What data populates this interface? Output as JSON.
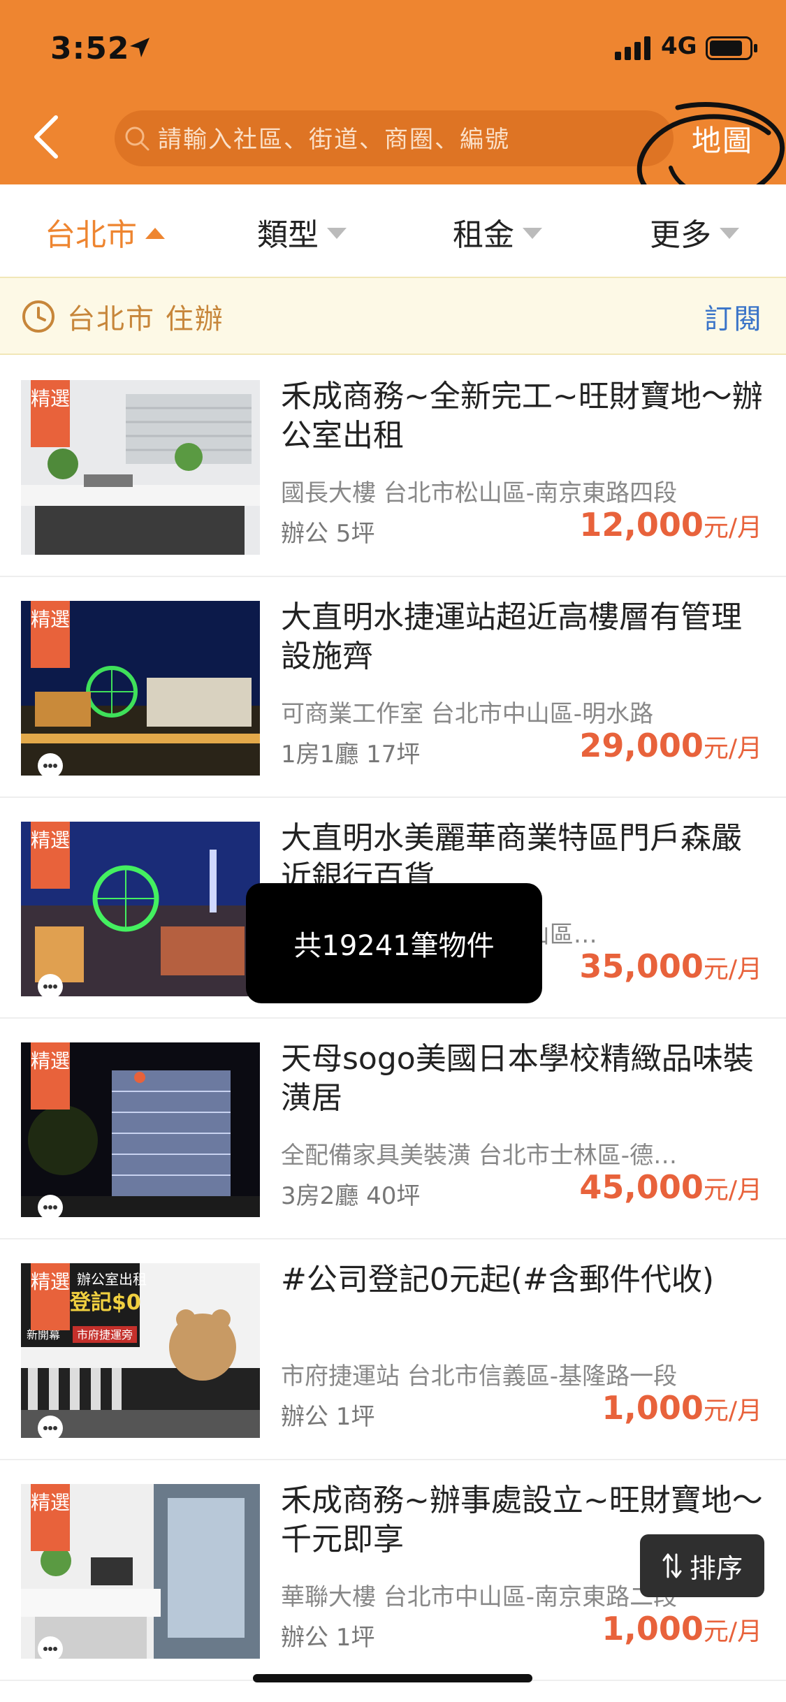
{
  "status_bar": {
    "time": "3:52",
    "network": "4G"
  },
  "header": {
    "search_placeholder": "請輸入社區、街道、商圈、編號",
    "map_label": "地圖"
  },
  "filters": [
    {
      "label": "台北市"
    },
    {
      "label": "類型"
    },
    {
      "label": "租金"
    },
    {
      "label": "更多"
    }
  ],
  "subscription": {
    "text": "台北市 住辦",
    "action": "訂閱"
  },
  "listings": [
    {
      "badge": "精選",
      "title": "禾成商務~全新完工~旺財寶地～辦公室出租",
      "location": "國長大樓 台北市松山區-南京東路四段",
      "spec": "辦公  5坪",
      "price": "12,000",
      "unit": "元/月"
    },
    {
      "badge": "精選",
      "title": "大直明水捷運站超近高樓層有管理設施齊",
      "location": "可商業工作室 台北市中山區-明水路",
      "spec": "1房1廳  17坪",
      "price": "29,000",
      "unit": "元/月"
    },
    {
      "badge": "精選",
      "title": "大直明水美麗華商業特區門戶森嚴近銀行百貨",
      "location": "可商業工作室 台北市中山區…",
      "spec": "",
      "price": "35,000",
      "unit": "元/月"
    },
    {
      "badge": "精選",
      "title": "天母sogo美國日本學校精緻品味裝潢居",
      "location": "全配備家具美裝潢 台北市士林區-德…",
      "spec": "3房2廳  40坪",
      "price": "45,000",
      "unit": "元/月"
    },
    {
      "badge": "精選",
      "title": "#公司登記0元起(#含郵件代收)",
      "location": "市府捷運站 台北市信義區-基隆路一段",
      "spec": "辦公  1坪",
      "price": "1,000",
      "unit": "元/月"
    },
    {
      "badge": "精選",
      "title": "禾成商務~辦事處設立~旺財寶地～千元即享",
      "location": "華聯大樓 台北市中山區-南京東路二段",
      "spec": "辦公  1坪",
      "price": "1,000",
      "unit": "元/月"
    }
  ],
  "thumb5_text": {
    "line1": "辦公室出租",
    "line2": "登記$0",
    "line3": "新開幕",
    "line4": "市府捷運旁"
  },
  "toast": "共19241筆物件",
  "sort_label": "排序"
}
